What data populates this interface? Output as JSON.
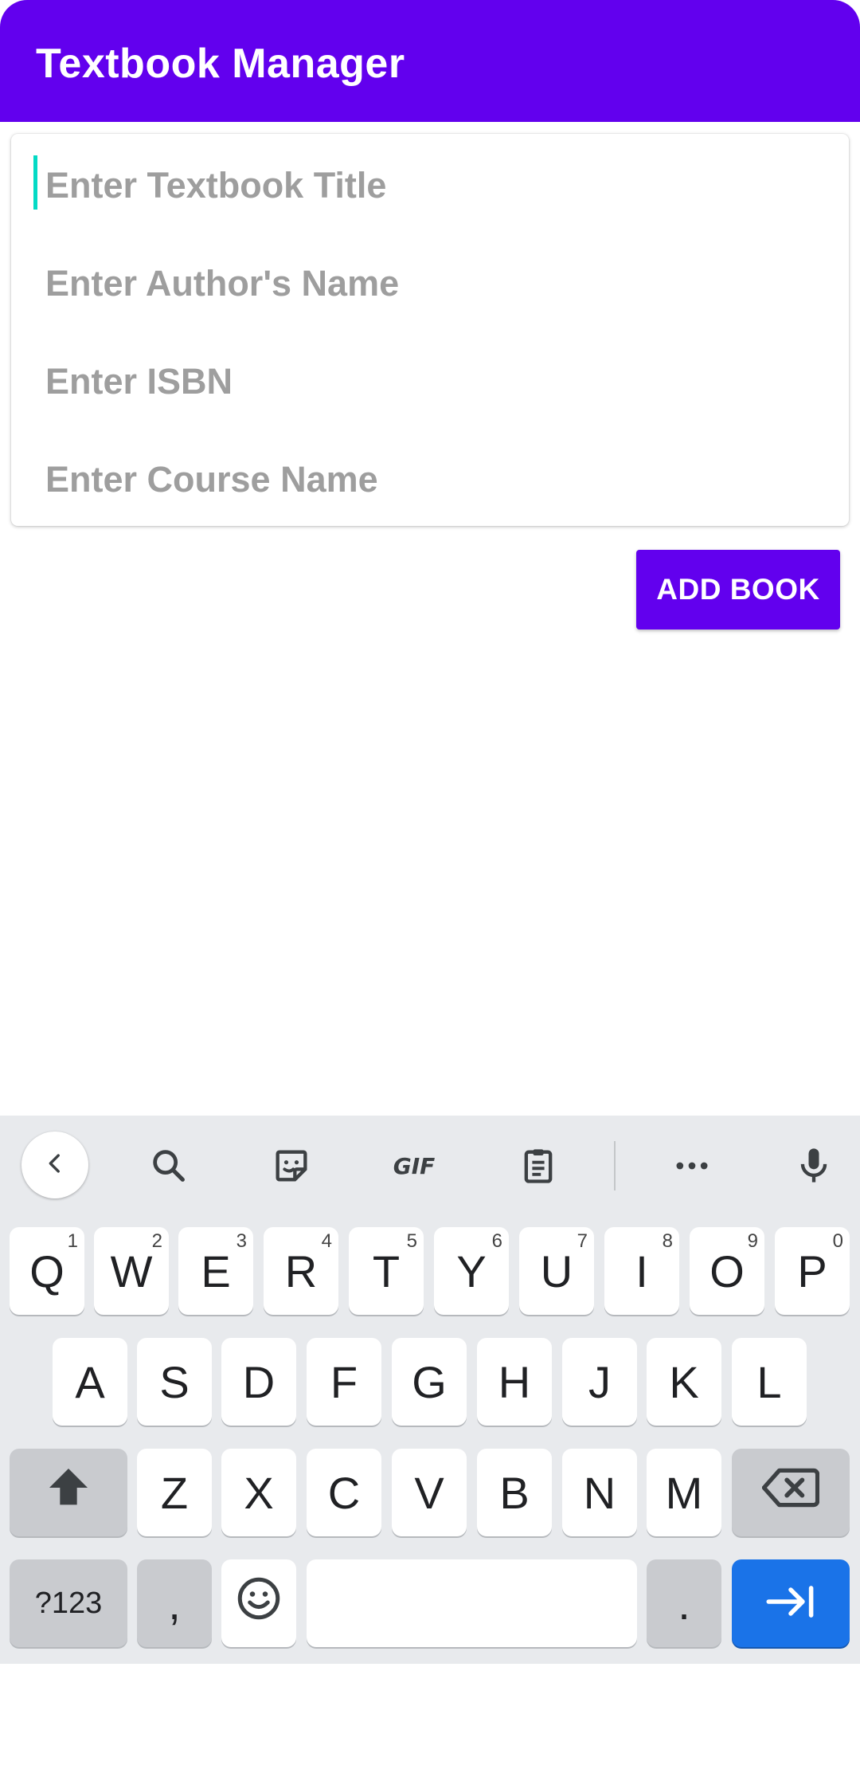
{
  "app": {
    "title": "Textbook Manager"
  },
  "form": {
    "title_placeholder": "Enter Textbook Title",
    "author_placeholder": "Enter Author's Name",
    "isbn_placeholder": "Enter ISBN",
    "course_placeholder": "Enter Course Name"
  },
  "actions": {
    "add_label": "ADD BOOK"
  },
  "keyboard": {
    "row1": [
      {
        "k": "Q",
        "h": "1"
      },
      {
        "k": "W",
        "h": "2"
      },
      {
        "k": "E",
        "h": "3"
      },
      {
        "k": "R",
        "h": "4"
      },
      {
        "k": "T",
        "h": "5"
      },
      {
        "k": "Y",
        "h": "6"
      },
      {
        "k": "U",
        "h": "7"
      },
      {
        "k": "I",
        "h": "8"
      },
      {
        "k": "O",
        "h": "9"
      },
      {
        "k": "P",
        "h": "0"
      }
    ],
    "row2": [
      "A",
      "S",
      "D",
      "F",
      "G",
      "H",
      "J",
      "K",
      "L"
    ],
    "row3": [
      "Z",
      "X",
      "C",
      "V",
      "B",
      "N",
      "M"
    ],
    "symbols_label": "?123",
    "comma": ",",
    "period": "."
  },
  "colors": {
    "primary": "#6200ee",
    "accent": "#03dac5",
    "enter_key": "#1a73e8"
  }
}
